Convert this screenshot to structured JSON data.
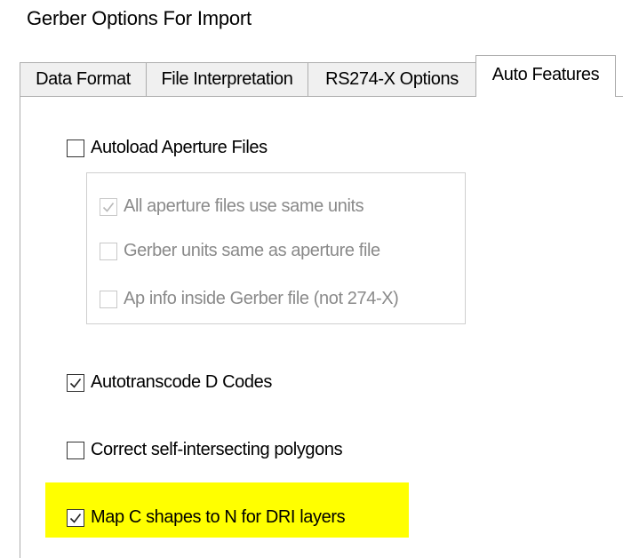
{
  "window": {
    "title": "Gerber Options For Import"
  },
  "tabs": [
    {
      "label": "Data Format",
      "active": false
    },
    {
      "label": "File Interpretation",
      "active": false
    },
    {
      "label": "RS274-X Options",
      "active": false
    },
    {
      "label": "Auto Features",
      "active": true
    }
  ],
  "options": {
    "autoload": {
      "label": "Autoload Aperture Files",
      "checked": false,
      "enabled": true
    },
    "aperture_group": [
      {
        "label": "All aperture files use same units",
        "checked": true,
        "enabled": false
      },
      {
        "label": "Gerber units same as aperture file",
        "checked": false,
        "enabled": false
      },
      {
        "label": "Ap info inside Gerber file (not 274-X)",
        "checked": false,
        "enabled": false
      }
    ],
    "autotranscode": {
      "label": "Autotranscode D Codes",
      "checked": true,
      "enabled": true
    },
    "correct_polygons": {
      "label": "Correct self-intersecting polygons",
      "checked": false,
      "enabled": true
    },
    "map_c_shapes": {
      "label": "Map C shapes to N for DRI layers",
      "checked": true,
      "enabled": true
    }
  },
  "colors": {
    "highlight": "#ffff00",
    "tab_inactive_bg": "#f0f0f0",
    "border": "#adadad",
    "disabled_text": "#8a8a8a"
  },
  "icons": {
    "checkmark": "check-icon"
  }
}
